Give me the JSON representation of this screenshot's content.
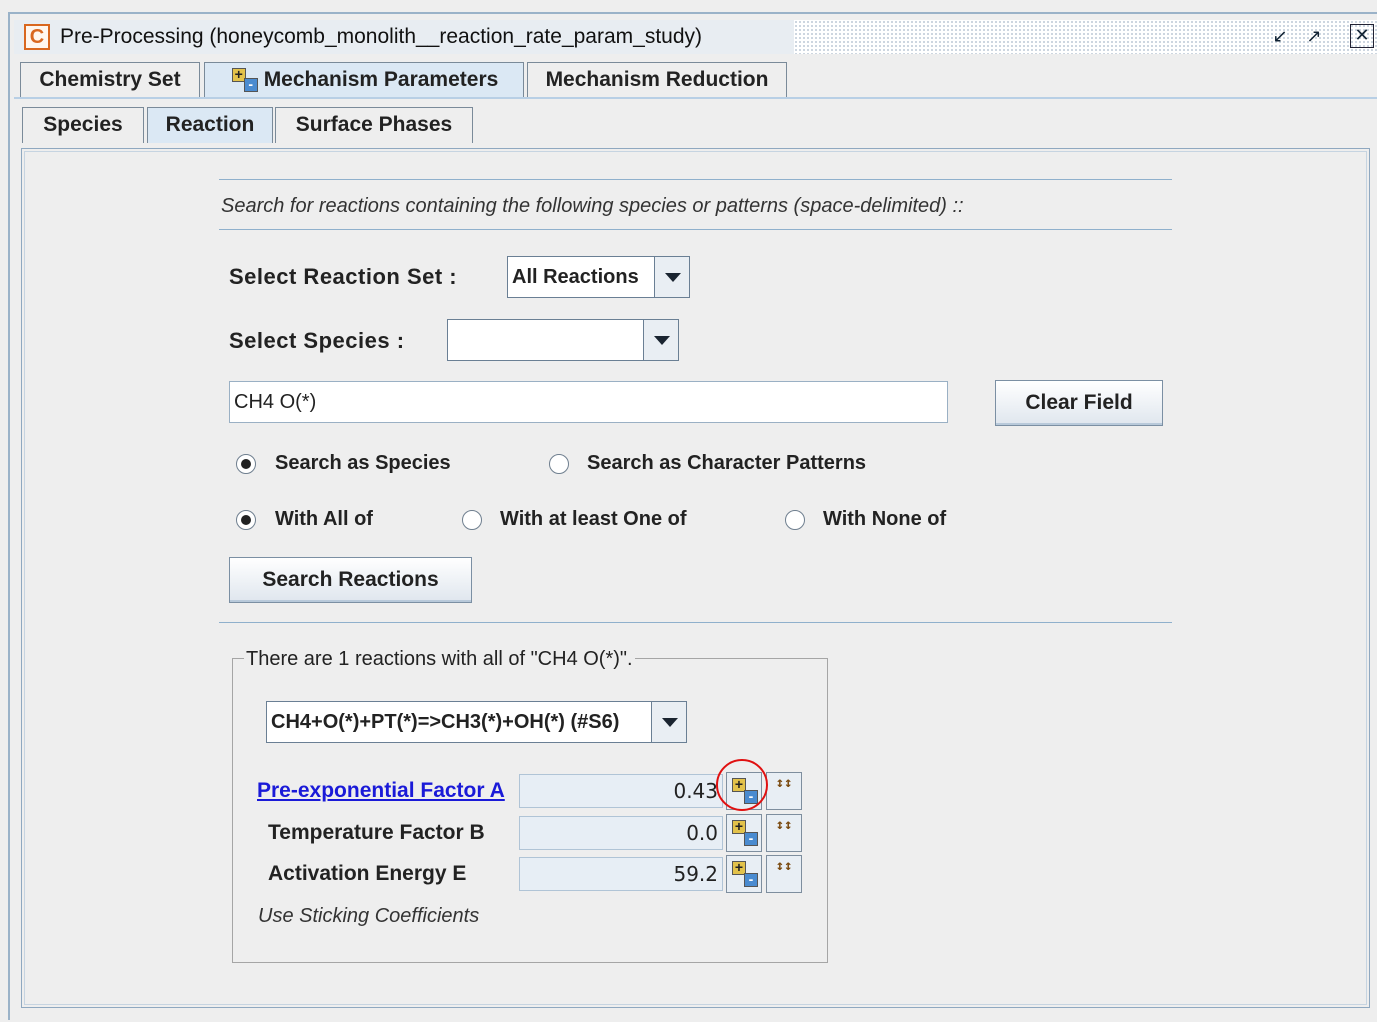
{
  "window": {
    "title": "Pre-Processing  (honeycomb_monolith__reaction_rate_param_study)",
    "app_icon_letter": "C",
    "controls": [
      "minimize-icon",
      "maximize-icon",
      "close-icon"
    ]
  },
  "main_tabs": [
    {
      "label": "Chemistry Set",
      "selected": false
    },
    {
      "label": "Mechanism Parameters",
      "selected": true,
      "icon": "plus-minus-icon"
    },
    {
      "label": "Mechanism Reduction",
      "selected": false
    }
  ],
  "sub_tabs": [
    {
      "label": "Species",
      "selected": false
    },
    {
      "label": "Reaction",
      "selected": true
    },
    {
      "label": "Surface Phases",
      "selected": false
    }
  ],
  "search": {
    "instructions": "Search for reactions containing the following species or patterns (space-delimited) ::",
    "reaction_set_label": "Select Reaction Set :",
    "reaction_set_value": "All Reactions",
    "species_label": "Select Species :",
    "species_value": "",
    "query_value": "CH4 O(*)",
    "clear_button": "Clear Field",
    "mode_options": [
      {
        "label": "Search as Species",
        "checked": true
      },
      {
        "label": "Search as Character Patterns",
        "checked": false
      }
    ],
    "match_options": [
      {
        "label": "With All of",
        "checked": true
      },
      {
        "label": "With at least One of",
        "checked": false
      },
      {
        "label": "With None of",
        "checked": false
      }
    ],
    "search_button": "Search Reactions"
  },
  "results": {
    "summary": "There are 1 reactions with all of \"CH4 O(*)\".",
    "selected_reaction": "CH4+O(*)+PT(*)=>CH3(*)+OH(*) (#S6)",
    "params": [
      {
        "label": "Pre-exponential Factor A",
        "value": "0.43",
        "is_link": true
      },
      {
        "label": "Temperature Factor B",
        "value": "0.0",
        "is_link": false
      },
      {
        "label": "Activation Energy E",
        "value": "59.2",
        "is_link": false
      }
    ],
    "sticking_note": "Use Sticking Coefficients"
  },
  "colors": {
    "selected_tab": "#dbe8f4",
    "link": "#1a1ad8",
    "highlight_circle": "#e01010",
    "app_icon": "#d9671f"
  }
}
